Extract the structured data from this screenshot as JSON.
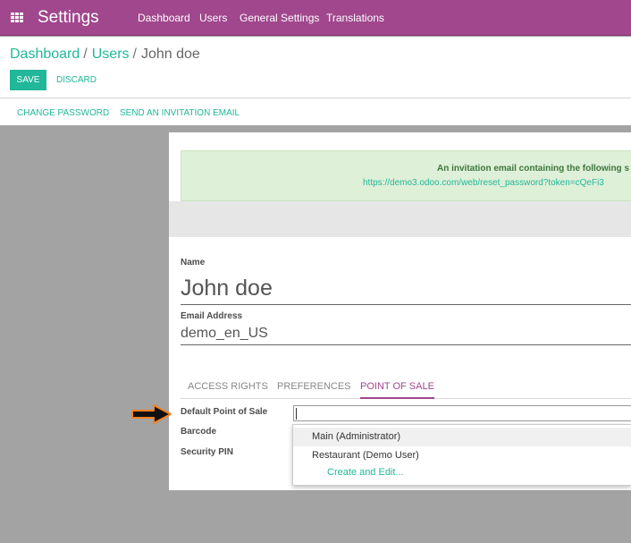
{
  "navbar": {
    "app_title": "Settings",
    "menu": [
      "Dashboard",
      "Users",
      "General Settings",
      "Translations"
    ],
    "color": "#a0478d"
  },
  "breadcrumb": {
    "items": [
      "Dashboard",
      "Users"
    ],
    "current": "John doe"
  },
  "actions": {
    "save_label": "SAVE",
    "discard_label": "DISCARD"
  },
  "header_buttons": [
    "CHANGE PASSWORD",
    "SEND AN INVITATION EMAIL"
  ],
  "alert": {
    "title": "An invitation email containing the following s",
    "link": "https://demo3.odoo.com/web/reset_password?token=cQeFi3"
  },
  "form": {
    "name_label": "Name",
    "name_value": "John doe",
    "email_label": "Email Address",
    "email_value": "demo_en_US",
    "tabs": [
      {
        "label": "ACCESS RIGHTS",
        "active": false
      },
      {
        "label": "PREFERENCES",
        "active": false
      },
      {
        "label": "POINT OF SALE",
        "active": true
      }
    ],
    "default_pos_label": "Default Point of Sale",
    "barcode_label": "Barcode",
    "security_pin_label": "Security PIN"
  },
  "dropdown": {
    "options": [
      "Main (Administrator)",
      "Restaurant (Demo User)"
    ],
    "create_edit": "Create and Edit..."
  },
  "colors": {
    "accent": "#21b799",
    "brand": "#a0478d",
    "alert_bg": "#dff0d8",
    "pointer_arrow_outline": "#f58220"
  },
  "icons": {
    "apps": "apps-grid-icon",
    "pointer": "pointer-arrow-icon"
  }
}
